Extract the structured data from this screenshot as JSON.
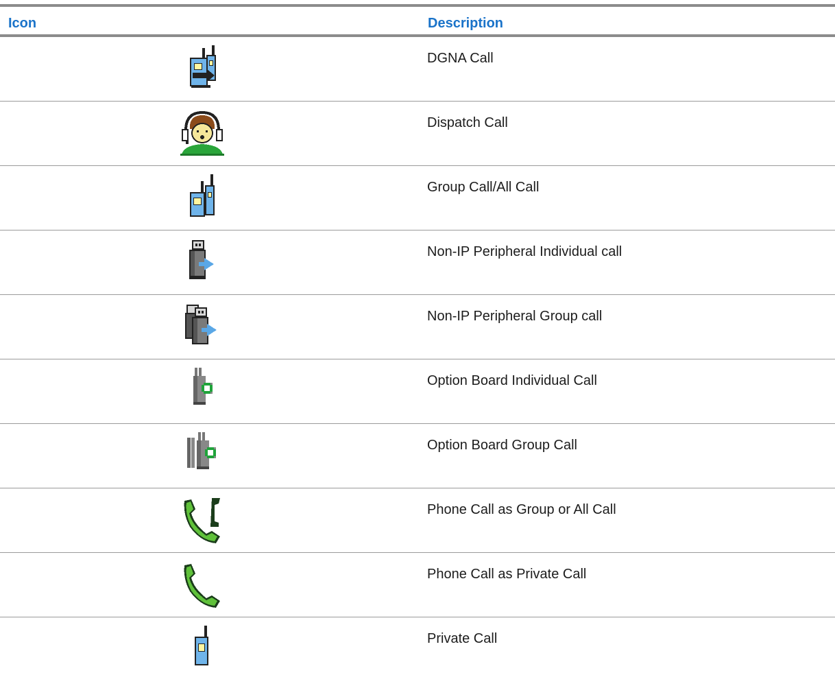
{
  "table": {
    "headers": {
      "icon": "Icon",
      "description": "Description"
    },
    "rows": [
      {
        "icon": "dgna-call-icon",
        "description": "DGNA Call"
      },
      {
        "icon": "dispatch-call-icon",
        "description": "Dispatch Call"
      },
      {
        "icon": "group-call-icon",
        "description": "Group Call/All Call"
      },
      {
        "icon": "non-ip-peripheral-individual-icon",
        "description": "Non-IP Peripheral Individual call"
      },
      {
        "icon": "non-ip-peripheral-group-icon",
        "description": "Non-IP Peripheral Group call"
      },
      {
        "icon": "option-board-individual-icon",
        "description": "Option Board Individual Call"
      },
      {
        "icon": "option-board-group-icon",
        "description": "Option Board Group Call"
      },
      {
        "icon": "phone-call-group-icon",
        "description": "Phone Call as Group or All Call"
      },
      {
        "icon": "phone-call-private-icon",
        "description": "Phone Call as Private Call"
      },
      {
        "icon": "private-call-icon",
        "description": "Private Call"
      }
    ]
  },
  "colors": {
    "header_text": "#1a73c9",
    "rule": "#8c8c8c",
    "radio_blue": "#6fb4ea",
    "phone_green": "#5fc13a",
    "option_green": "#1fa33a"
  }
}
